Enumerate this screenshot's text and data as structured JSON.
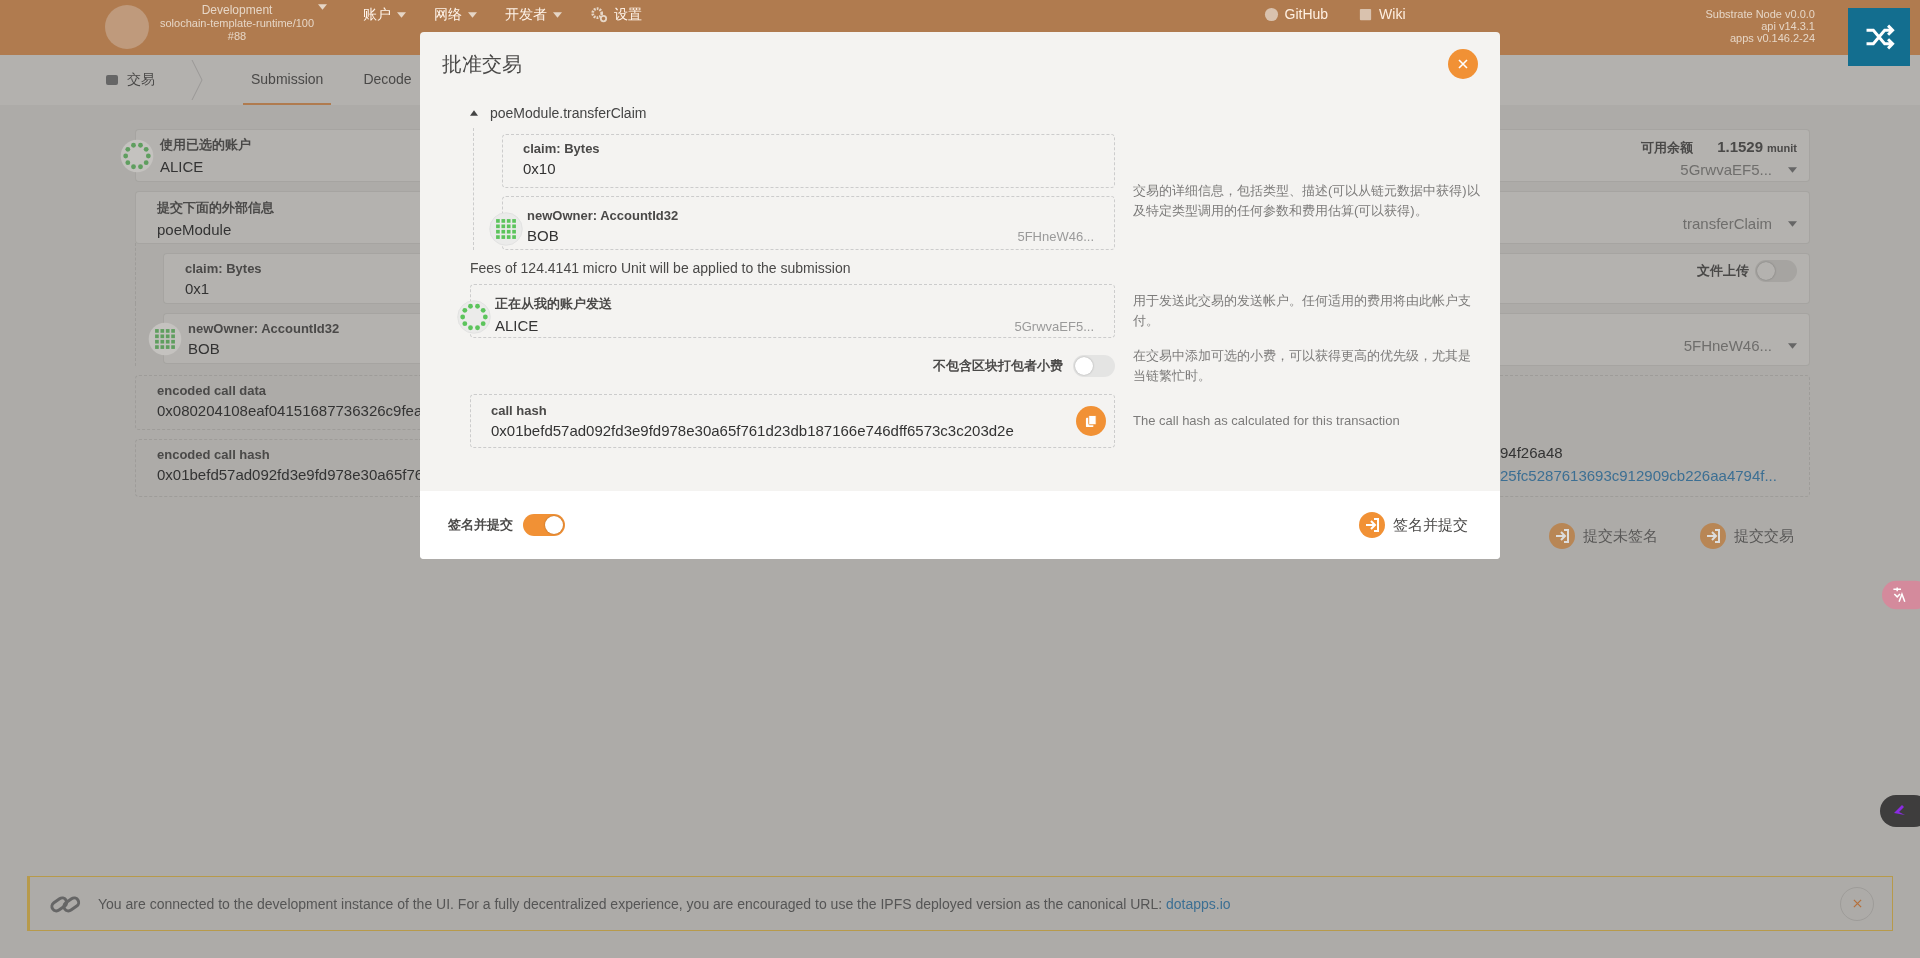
{
  "header": {
    "chain": {
      "name": "Development",
      "runtime": "solochain-template-runtime/100",
      "block": "#88"
    },
    "menu": [
      {
        "label": "账户",
        "kind": "dropdown"
      },
      {
        "label": "网络",
        "kind": "dropdown"
      },
      {
        "label": "开发者",
        "kind": "dropdown"
      },
      {
        "label": "设置",
        "kind": "settings"
      }
    ],
    "links": [
      {
        "label": "GitHub",
        "kind": "github"
      },
      {
        "label": "Wiki",
        "kind": "wiki"
      }
    ],
    "versions": [
      "Substrate Node v0.0.0",
      "api v14.3.1",
      "apps v0.146.2-24"
    ]
  },
  "subnav": {
    "section": "交易",
    "tabs": [
      {
        "label": "Submission",
        "selected": true
      },
      {
        "label": "Decode",
        "selected": false
      }
    ]
  },
  "form": {
    "account": {
      "label": "使用已选的账户",
      "value": "ALICE",
      "balance_label": "可用余额",
      "balance": "1.1529",
      "balance_unit": "munit",
      "address": "5GrwvaEF5..."
    },
    "extrinsic": {
      "label": "提交下面的外部信息",
      "module": "poeModule",
      "method": "transferClaim"
    },
    "claim": {
      "label": "claim: Bytes",
      "value": "0x1",
      "file_upload_label": "文件上传",
      "file_upload": false
    },
    "new_owner": {
      "label": "newOwner: AccountId32",
      "value": "BOB",
      "address": "5FHneW46..."
    },
    "encoded": {
      "data_label": "encoded call data",
      "data_value": "0x080204108eaf04151687736326c9fea",
      "hash_label": "encoded call hash",
      "hash_value": "0x01befd57ad092fd3e9fd978e30a65f76",
      "tail": "94f26a48",
      "link": "25fc5287613693c912909cb226aa4794f..."
    },
    "buttons": [
      "提交未签名",
      "提交交易"
    ]
  },
  "modal": {
    "title": "批准交易",
    "call": {
      "name": "poeModule.transferClaim",
      "expanded": true,
      "params": [
        {
          "kind": "bytes",
          "label": "claim: Bytes",
          "value": "0x10"
        },
        {
          "kind": "account",
          "label": "newOwner: AccountId32",
          "value": "BOB",
          "address": "5FHneW46..."
        }
      ]
    },
    "call_help": "交易的详细信息，包括类型、描述(可以从链元数据中获得)以及特定类型调用的任何参数和费用估算(可以获得)。",
    "fees": "Fees of 124.4141 micro Unit will be applied to the submission",
    "sender": {
      "label": "正在从我的账户发送",
      "value": "ALICE",
      "address": "5GrwvaEF5...",
      "help": "用于发送此交易的发送帐户。任何适用的费用将由此帐户支付。"
    },
    "tip": {
      "label": "不包含区块打包者小费",
      "on": false,
      "help": "在交易中添加可选的小费，可以获得更高的优先级，尤其是当链繁忙时。"
    },
    "call_hash": {
      "label": "call hash",
      "value": "0x01befd57ad092fd3e9fd978e30a65f761d23db187166e746dff6573c3c203d2e",
      "help": "The call hash as calculated for this transaction"
    },
    "sign_toggle": {
      "label": "签名并提交",
      "on": true
    },
    "submit": "签名并提交"
  },
  "banner": {
    "text": "You are connected to the development instance of the UI. For a fully decentralized experience, you are encouraged to use the IPFS deployed version as the canonical URL:",
    "link": "dotapps.io"
  }
}
